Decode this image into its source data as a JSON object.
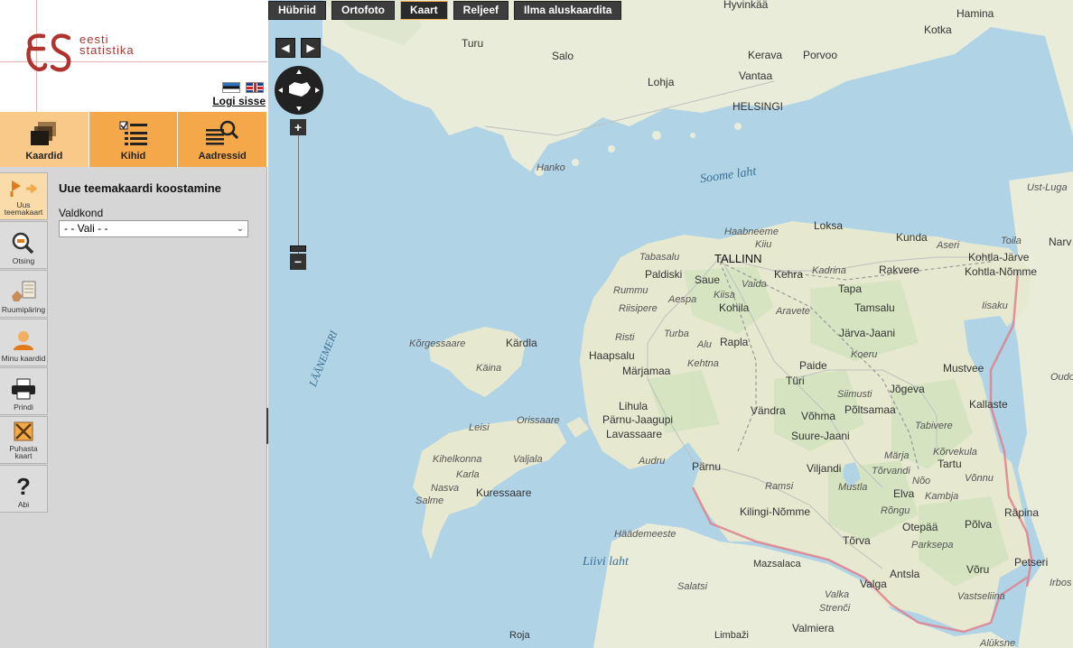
{
  "logo": {
    "line1": "eesti",
    "line2": "statistika"
  },
  "header": {
    "login_label": "Logi sisse",
    "flags": [
      "flag-estonia",
      "flag-uk"
    ]
  },
  "tabs": [
    {
      "label": "Kaardid",
      "icon": "layers-icon",
      "active": true
    },
    {
      "label": "Kihid",
      "icon": "checklist-icon",
      "active": false
    },
    {
      "label": "Aadressid",
      "icon": "address-search-icon",
      "active": false
    }
  ],
  "tools": [
    {
      "label": "Uus teemakaart",
      "icon": "new-map-icon",
      "active": true
    },
    {
      "label": "Otsing",
      "icon": "search-icon",
      "active": false
    },
    {
      "label": "Ruumipäring",
      "icon": "spatial-query-icon",
      "active": false
    },
    {
      "label": "Minu kaardid",
      "icon": "user-maps-icon",
      "active": false
    },
    {
      "label": "Prindi",
      "icon": "printer-icon",
      "active": false
    },
    {
      "label": "Puhasta kaart",
      "icon": "clear-map-icon",
      "active": false
    },
    {
      "label": "Abi",
      "icon": "help-icon",
      "active": false
    }
  ],
  "form": {
    "title": "Uue teemakaardi koostamine",
    "field_label": "Valdkond",
    "select_value": "- - Vali - -"
  },
  "map": {
    "layer_buttons": [
      "Hübriid",
      "Ortofoto",
      "Kaart",
      "Reljeef",
      "Ilma aluskaardita"
    ],
    "active_layer": "Kaart",
    "zoom_in": "+",
    "zoom_out": "−",
    "colors": {
      "sea": "#b0d4e6",
      "land": "#e9ecd8",
      "forest": "#d4e3c0",
      "border": "#e07a8a",
      "accent": "#f4a84a"
    },
    "labels": {
      "hyvinkaa": "Hyvinkää",
      "hamina": "Hamina",
      "kotka": "Kotka",
      "turu": "Turu",
      "salo": "Salo",
      "kerava": "Kerava",
      "porvoo": "Porvoo",
      "vantaa": "Vantaa",
      "lohja": "Lohja",
      "helsingi": "HELSINGI",
      "hanko": "Hanko",
      "soome_laht": "Soome laht",
      "ust_luga": "Ust-Luga",
      "loksa": "Loksa",
      "kunda": "Kunda",
      "haabneeme": "Haabneeme",
      "kiiu": "Kiiu",
      "tabasalu": "Tabasalu",
      "tallinn": "TALLINN",
      "aseri": "Aseri",
      "toila": "Toila",
      "narva": "Narv",
      "kohtla_jarve": "Kohtla-Järve",
      "kohtla_nomme": "Kohtla-Nõmme",
      "paldiski": "Paldiski",
      "saue": "Saue",
      "kehra": "Kehra",
      "kadrina": "Kadrina",
      "rakvere": "Rakvere",
      "rummu": "Rummu",
      "vaida": "Vaida",
      "aespa": "Aespa",
      "kiisa": "Kiisa",
      "tapa": "Tapa",
      "riisipere": "Riisipere",
      "kohila": "Kohila",
      "aravete": "Aravete",
      "tamsalu": "Tamsalu",
      "iisaku": "Iisaku",
      "korgessaare": "Kõrgessaare",
      "kardla": "Kärdla",
      "risti": "Risti",
      "turba": "Turba",
      "alu": "Alu",
      "rapla": "Rapla",
      "jarva_jaani": "Järva-Jaani",
      "haapsalu": "Haapsalu",
      "koeru": "Koeru",
      "kaina": "Käina",
      "marjamaa": "Märjamaa",
      "kehtna": "Kehtna",
      "paide": "Paide",
      "mustvee": "Mustvee",
      "oudova": "Oudova",
      "turi": "Türi",
      "laanemeri": "LÄÄNEMERI",
      "siimusti": "Siimusti",
      "jogeva": "Jõgeva",
      "lihula": "Lihula",
      "kallaste": "Kallaste",
      "vandra": "Vändra",
      "vohma": "Võhma",
      "poltsamaa": "Põltsamaa",
      "leisi": "Leisi",
      "orissaare": "Orissaare",
      "pamu_jaagupi": "Pärnu-Jaagupi",
      "tabivere": "Tabivere",
      "lavassaare": "Lavassaare",
      "suure_jaani": "Suure-Jaani",
      "marja": "Märja",
      "korvekula": "Kõrvekula",
      "kihelkonna": "Kihelkonna",
      "valjala": "Valjala",
      "audru": "Audru",
      "torvandi": "Tõrvandi",
      "tartu": "Tartu",
      "parnu": "Pärnu",
      "viljandi": "Viljandi",
      "vonnu": "Võnnu",
      "karla": "Karla",
      "nasva": "Nasva",
      "kuressaare": "Kuressaare",
      "noo": "Nõo",
      "kambja": "Kambja",
      "ramsi": "Ramsi",
      "mustla": "Mustla",
      "elva": "Elva",
      "salme": "Salme",
      "rongu": "Rõngu",
      "rapina": "Räpina",
      "kilingi_nomme": "Kilingi-Nõmme",
      "otepaa": "Otepää",
      "polva": "Põlva",
      "haademeeste": "Häädemeeste",
      "torva": "Tõrva",
      "parksepa": "Parksepa",
      "liivi_laht": "Liivi laht",
      "mazsalaca": "Mazsalaca",
      "antsla": "Antsla",
      "voru": "Võru",
      "petseri": "Petseri",
      "salatsi": "Salatsi",
      "valga": "Valga",
      "vastseliina": "Vastseliina",
      "irbos": "Irbos",
      "valka": "Valka",
      "strenci": "Strenči",
      "valmiera": "Valmiera",
      "limbazi": "Limbaži",
      "roja": "Roja",
      "aluksne": "Alūksne"
    }
  }
}
